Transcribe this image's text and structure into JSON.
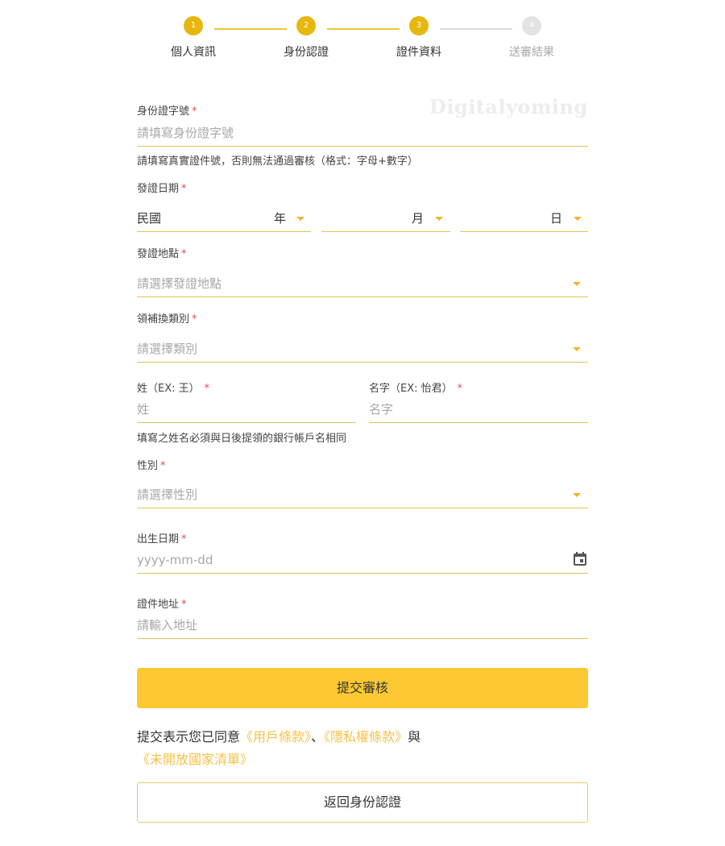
{
  "stepper": {
    "steps": [
      {
        "num": "1",
        "label": "個人資訊"
      },
      {
        "num": "2",
        "label": "身份認證"
      },
      {
        "num": "3",
        "label": "證件資料"
      },
      {
        "num": "4",
        "label": "送審結果"
      }
    ]
  },
  "watermark": "Digitalyoming",
  "form": {
    "id_number": {
      "label": "身份證字號",
      "placeholder": "請填寫身份證字號",
      "hint": "請填寫真實證件號，否則無法通過審核（格式：字母+數字）"
    },
    "issue_date": {
      "label": "發證日期",
      "era": "民國",
      "year": "年",
      "month": "月",
      "day": "日"
    },
    "issue_place": {
      "label": "發證地點",
      "placeholder": "請選擇發證地點"
    },
    "issue_type": {
      "label": "領補換類別",
      "placeholder": "請選擇類別"
    },
    "surname": {
      "label": "姓（EX: 王）",
      "placeholder": "姓"
    },
    "given_name": {
      "label": "名字（EX: 怡君）",
      "placeholder": "名字"
    },
    "name_hint": "填寫之姓名必須與日後提領的銀行帳戶名相同",
    "gender": {
      "label": "性別",
      "placeholder": "請選擇性別"
    },
    "birth_date": {
      "label": "出生日期",
      "placeholder": "yyyy-mm-dd"
    },
    "address": {
      "label": "證件地址",
      "placeholder": "請輸入地址"
    },
    "required_mark": "*"
  },
  "actions": {
    "submit": "提交審核",
    "agree_prefix": "提交表示您已同意",
    "terms_link": "《用戶條款》",
    "separator": "、",
    "privacy_link": "《隱私權條款》",
    "and": "與",
    "countries_link": "《未開放國家清單》",
    "back": "返回身份認證"
  },
  "colors": {
    "accent": "#fdc933",
    "step_done": "#e8b70e",
    "link": "#f5c24a",
    "required": "#e34b4b"
  }
}
